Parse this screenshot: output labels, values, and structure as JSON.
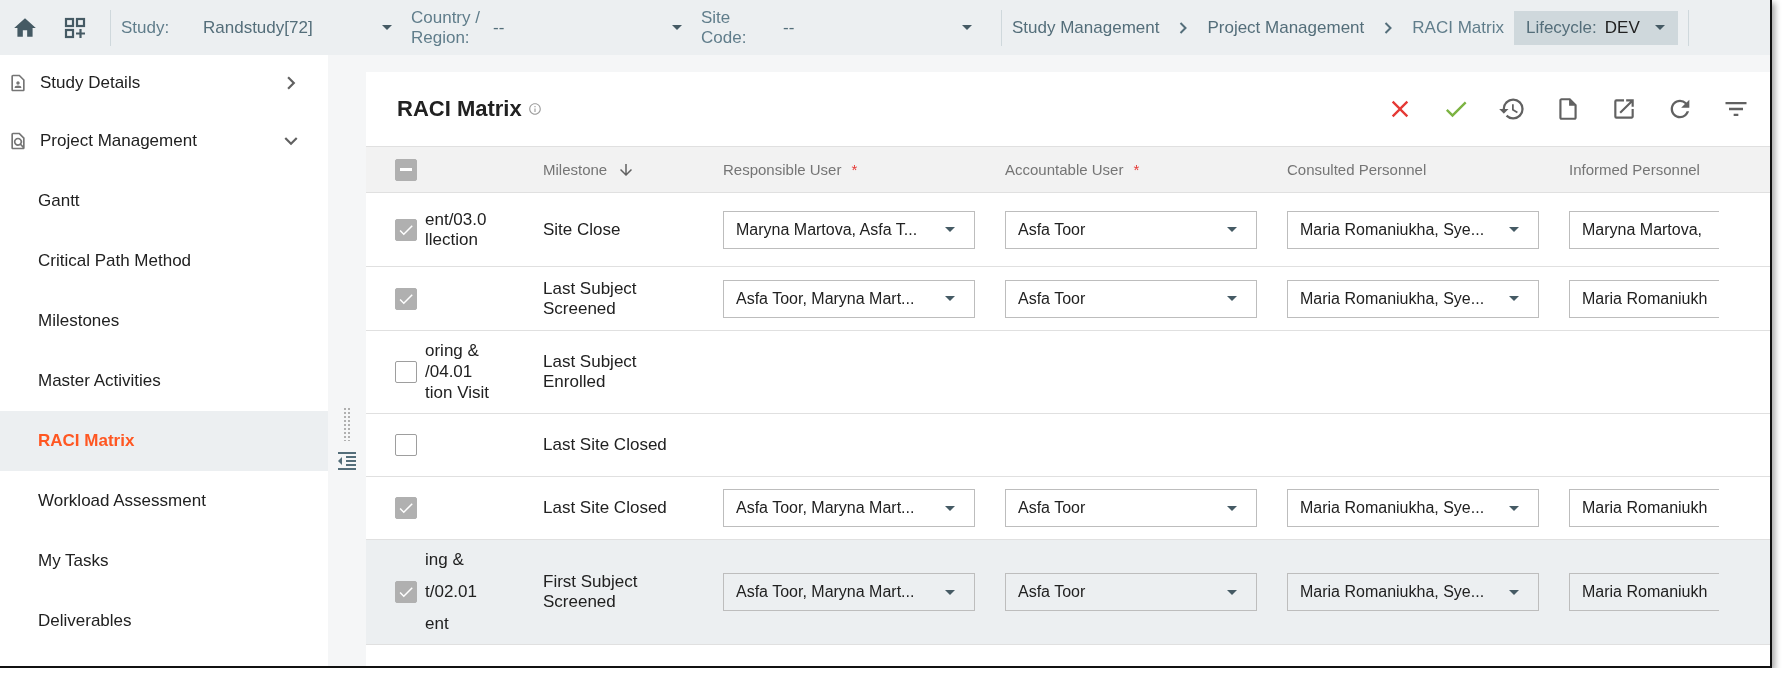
{
  "top_bar": {
    "filters": [
      {
        "label": "Study:",
        "value": "Randstudy[72]"
      },
      {
        "label": "Country / Region:",
        "value": "--"
      },
      {
        "label": "Site Code:",
        "value": "--"
      }
    ],
    "breadcrumbs": [
      "Study Management",
      "Project Management",
      "RACI Matrix"
    ],
    "lifecycle": {
      "label": "Lifecycle:",
      "value": "DEV"
    }
  },
  "sidebar": {
    "items": [
      {
        "label": "Study Details",
        "expanded": false
      },
      {
        "label": "Project Management",
        "expanded": true,
        "children": [
          {
            "label": "Gantt",
            "selected": false
          },
          {
            "label": "Critical Path Method",
            "selected": false
          },
          {
            "label": "Milestones",
            "selected": false
          },
          {
            "label": "Master Activities",
            "selected": false
          },
          {
            "label": "RACI Matrix",
            "selected": true
          },
          {
            "label": "Workload Assessment",
            "selected": false
          },
          {
            "label": "My Tasks",
            "selected": false
          },
          {
            "label": "Deliverables",
            "selected": false
          }
        ]
      }
    ]
  },
  "card": {
    "title": "RACI Matrix"
  },
  "table": {
    "header_checkbox": {
      "indeterminate": true
    },
    "columns": [
      {
        "label": "Milestone",
        "sorted": true
      },
      {
        "label": "Responsible User",
        "required_mark": "*",
        "sorted": false
      },
      {
        "label": "Accountable User",
        "required_mark": "*",
        "sorted": false
      },
      {
        "label": "Consulted Personnel",
        "sorted": false
      },
      {
        "label": "Informed Personnel",
        "sorted": false
      }
    ],
    "rows": [
      {
        "checked": true,
        "selected": false,
        "column_2": [
          "ent/03.0",
          "llection"
        ],
        "milestone": "Site Close",
        "responsible": "Maryna Martova, Asfa T...",
        "accountable": "Asfa Toor",
        "consulted": "Maria Romaniukha, Sye...",
        "informed": "Maryna Martova,"
      },
      {
        "checked": true,
        "selected": false,
        "column_2": [],
        "milestone": "Last Subject Screened",
        "responsible": "Asfa Toor, Maryna Mart...",
        "accountable": "Asfa Toor",
        "consulted": "Maria Romaniukha, Sye...",
        "informed": "Maria Romaniukh"
      },
      {
        "checked": false,
        "selected": false,
        "column_2": [
          "oring &",
          "/04.01",
          "tion Visit"
        ],
        "milestone": "Last Subject Enrolled"
      },
      {
        "checked": false,
        "selected": false,
        "column_2": [],
        "milestone": "Last Site Closed"
      },
      {
        "checked": true,
        "selected": false,
        "column_2": [],
        "milestone": "Last Site Closed",
        "responsible": "Asfa Toor, Maryna Mart...",
        "accountable": "Asfa Toor",
        "consulted": "Maria Romaniukha, Sye...",
        "informed": "Maria Romaniukh"
      },
      {
        "checked": true,
        "selected": true,
        "column_2": [
          "ing &",
          "t/02.01",
          "ent"
        ],
        "milestone": "First Subject Screened",
        "responsible": "Asfa Toor, Maryna Mart...",
        "accountable": "Asfa Toor",
        "consulted": "Maria Romaniukha, Sye...",
        "informed": "Maria Romaniukh"
      }
    ]
  }
}
